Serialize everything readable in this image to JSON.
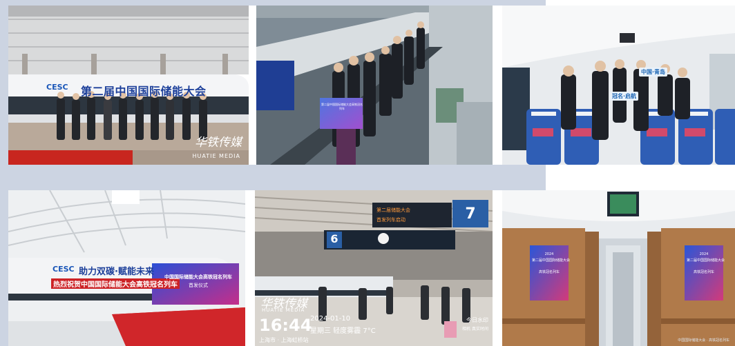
{
  "photos": [
    {
      "name": "ceremony-group-photo",
      "banner_text": "第二届中国国际储能大会",
      "logo_text": "CESC",
      "watermark_cn": "华铁传媒",
      "watermark_en": "HUATIE MEDIA"
    },
    {
      "name": "escalator-group-photo",
      "sign_text": "第二届中国国际储能大会高铁冠名列车"
    },
    {
      "name": "train-cabin-group-photo",
      "signs": [
        "中国·青岛",
        "冠名·启航"
      ]
    },
    {
      "name": "branded-train-ceremony",
      "logo_text": "CESC",
      "train_slogan": "助力双碳·赋能未来",
      "train_red_band": "热烈祝贺中国国际储能大会高铁冠名列车",
      "board_title": "中国国际储能大会高铁冠名列车",
      "board_subtitle": "首发仪式"
    },
    {
      "name": "station-platform",
      "platform_numbers": [
        "6",
        "7"
      ],
      "led_texts": [
        "第二届储能大会",
        "首发列车启动"
      ],
      "watermark_cn": "华铁传媒",
      "watermark_en": "HUATIE MEDIA",
      "time": "16:44",
      "date": "2024-01-10",
      "weekday_weather": "星期三 轻度雾霾 7°C",
      "location": "上海市 · 上海虹桥站",
      "stamp": "今日水印",
      "stamp_sub": "相机 真实时间"
    },
    {
      "name": "train-interior-posters",
      "poster_year": "2024",
      "poster_title": "第二届中国国际储能大会",
      "poster_sub": "高铁冠名列车",
      "footer_text": "中国国际储能大会 · 高铁冠名列车"
    }
  ],
  "colors": {
    "background": "#ffffff",
    "band": "#ccd4e2",
    "banner_blue": "#1c3f9a",
    "red": "#cc2226",
    "platform_sign": "#2a5fa5"
  }
}
